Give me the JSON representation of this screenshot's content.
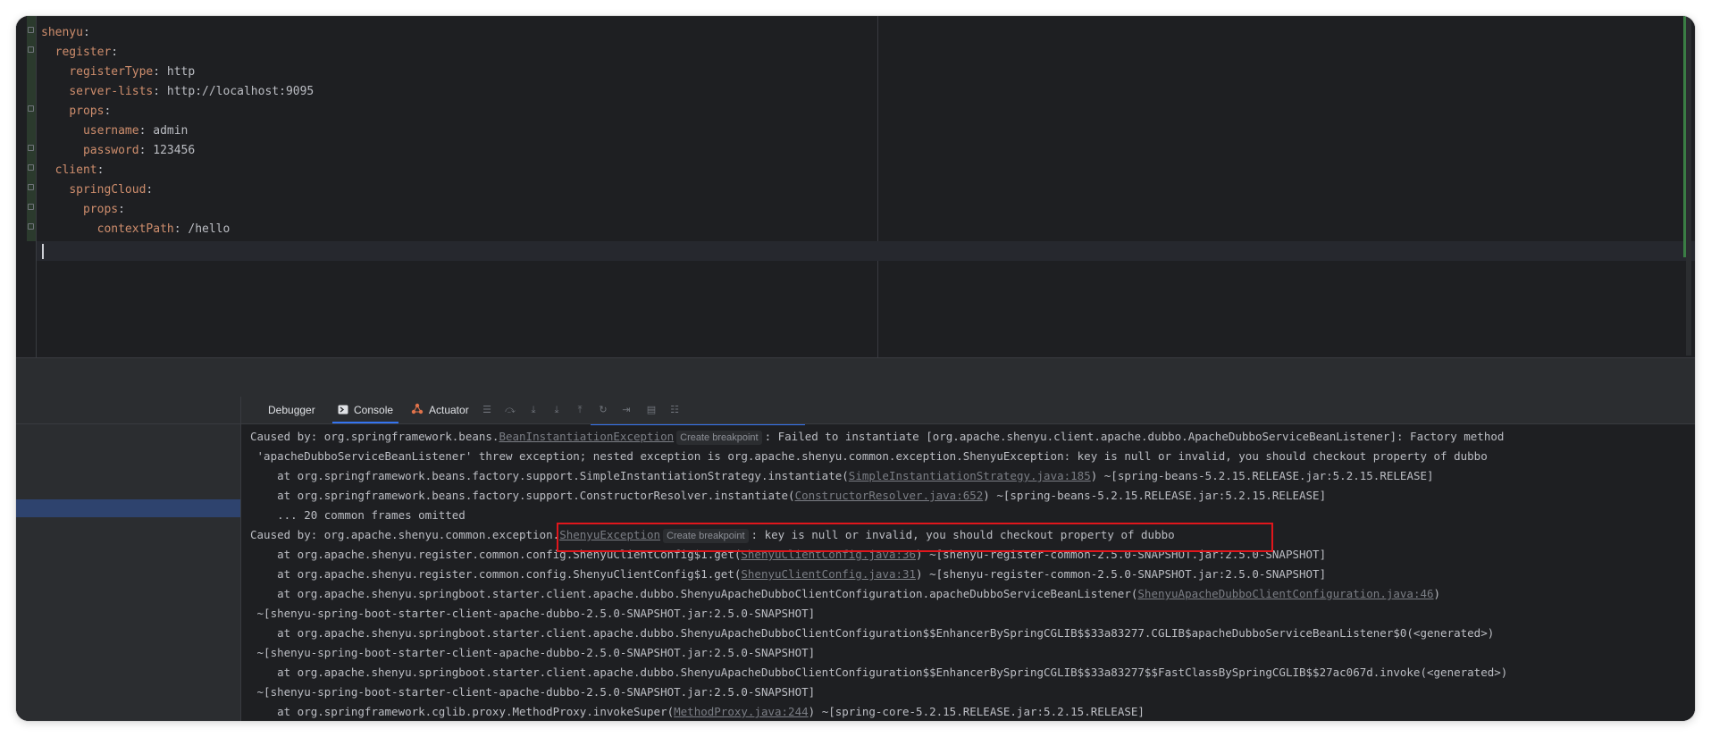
{
  "editor": {
    "lines": [
      {
        "key": "shenyu",
        "sep": ":",
        "value": ""
      },
      {
        "key": "register",
        "sep": ":",
        "value": ""
      },
      {
        "key": "registerType",
        "sep": ": ",
        "value": "http"
      },
      {
        "key": "server-lists",
        "sep": ": ",
        "value": "http://localhost:9095"
      },
      {
        "key": "props",
        "sep": ":",
        "value": ""
      },
      {
        "key": "username",
        "sep": ": ",
        "value": "admin"
      },
      {
        "key": "password",
        "sep": ": ",
        "value": "123456"
      },
      {
        "key": "client",
        "sep": ":",
        "value": ""
      },
      {
        "key": "springCloud",
        "sep": ":",
        "value": ""
      },
      {
        "key": "props",
        "sep": ":",
        "value": ""
      },
      {
        "key": "contextPath",
        "sep": ": ",
        "value": "/hello"
      }
    ]
  },
  "debug_panel": {
    "tabs": {
      "debugger": "Debugger",
      "console": "Console",
      "actuator": "Actuator"
    },
    "icons": [
      "layout-icon",
      "step-over-icon",
      "step-into-icon",
      "force-step-into-icon",
      "step-out-icon",
      "run-to-cursor-icon",
      "evaluate-icon",
      "table-icon",
      "settings-icon"
    ]
  },
  "console": {
    "breakpoint_label": "Create breakpoint",
    "l1_pre": "Caused by: org.springframework.beans.",
    "l1_link": "BeanInstantiationException",
    "l1_post": ": Failed to instantiate [org.apache.shenyu.client.apache.dubbo.ApacheDubboServiceBeanListener]: Factory method",
    "l2": " 'apacheDubboServiceBeanListener' threw exception; nested exception is org.apache.shenyu.common.exception.ShenyuException: key is null or invalid, you should checkout property of dubbo",
    "l3_pre": "    at org.springframework.beans.factory.support.SimpleInstantiationStrategy.instantiate(",
    "l3_link": "SimpleInstantiationStrategy.java:185",
    "l3_post": ") ~[spring-beans-5.2.15.RELEASE.jar:5.2.15.RELEASE]",
    "l4_pre": "    at org.springframework.beans.factory.support.ConstructorResolver.instantiate(",
    "l4_link": "ConstructorResolver.java:652",
    "l4_post": ") ~[spring-beans-5.2.15.RELEASE.jar:5.2.15.RELEASE]",
    "l5": "    ... 20 common frames omitted",
    "l6_pre": "Caused by: org.apache.shenyu.common.exception.",
    "l6_link": "ShenyuException",
    "l6_post": ": key is null or invalid, you should checkout property of dubbo",
    "l7_pre": "    at org.apache.shenyu.register.common.config.ShenyuClientConfig$1.get(",
    "l7_link": "ShenyuClientConfig.java:36",
    "l7_post": ") ~[shenyu-register-common-2.5.0-SNAPSHOT.jar:2.5.0-SNAPSHOT]",
    "l8_pre": "    at org.apache.shenyu.register.common.config.ShenyuClientConfig$1.get(",
    "l8_link": "ShenyuClientConfig.java:31",
    "l8_post": ") ~[shenyu-register-common-2.5.0-SNAPSHOT.jar:2.5.0-SNAPSHOT]",
    "l9_pre": "    at org.apache.shenyu.springboot.starter.client.apache.dubbo.ShenyuApacheDubboClientConfiguration.apacheDubboServiceBeanListener(",
    "l9_link": "ShenyuApacheDubboClientConfiguration.java:46",
    "l9_post": ")",
    "l10": " ~[shenyu-spring-boot-starter-client-apache-dubbo-2.5.0-SNAPSHOT.jar:2.5.0-SNAPSHOT]",
    "l11": "    at org.apache.shenyu.springboot.starter.client.apache.dubbo.ShenyuApacheDubboClientConfiguration$$EnhancerBySpringCGLIB$$33a83277.CGLIB$apacheDubboServiceBeanListener$0(<generated>)",
    "l12": " ~[shenyu-spring-boot-starter-client-apache-dubbo-2.5.0-SNAPSHOT.jar:2.5.0-SNAPSHOT]",
    "l13": "    at org.apache.shenyu.springboot.starter.client.apache.dubbo.ShenyuApacheDubboClientConfiguration$$EnhancerBySpringCGLIB$$33a83277$$FastClassBySpringCGLIB$$27ac067d.invoke(<generated>)",
    "l14": " ~[shenyu-spring-boot-starter-client-apache-dubbo-2.5.0-SNAPSHOT.jar:2.5.0-SNAPSHOT]",
    "l15_pre": "    at org.springframework.cglib.proxy.MethodProxy.invokeSuper(",
    "l15_link": "MethodProxy.java:244",
    "l15_post": ") ~[spring-core-5.2.15.RELEASE.jar:5.2.15.RELEASE]"
  },
  "colors": {
    "yaml_key": "#cf8e6d",
    "highlight_box": "#e0161c",
    "active_tab_underline": "#3574f0",
    "selection": "#2e436e"
  }
}
